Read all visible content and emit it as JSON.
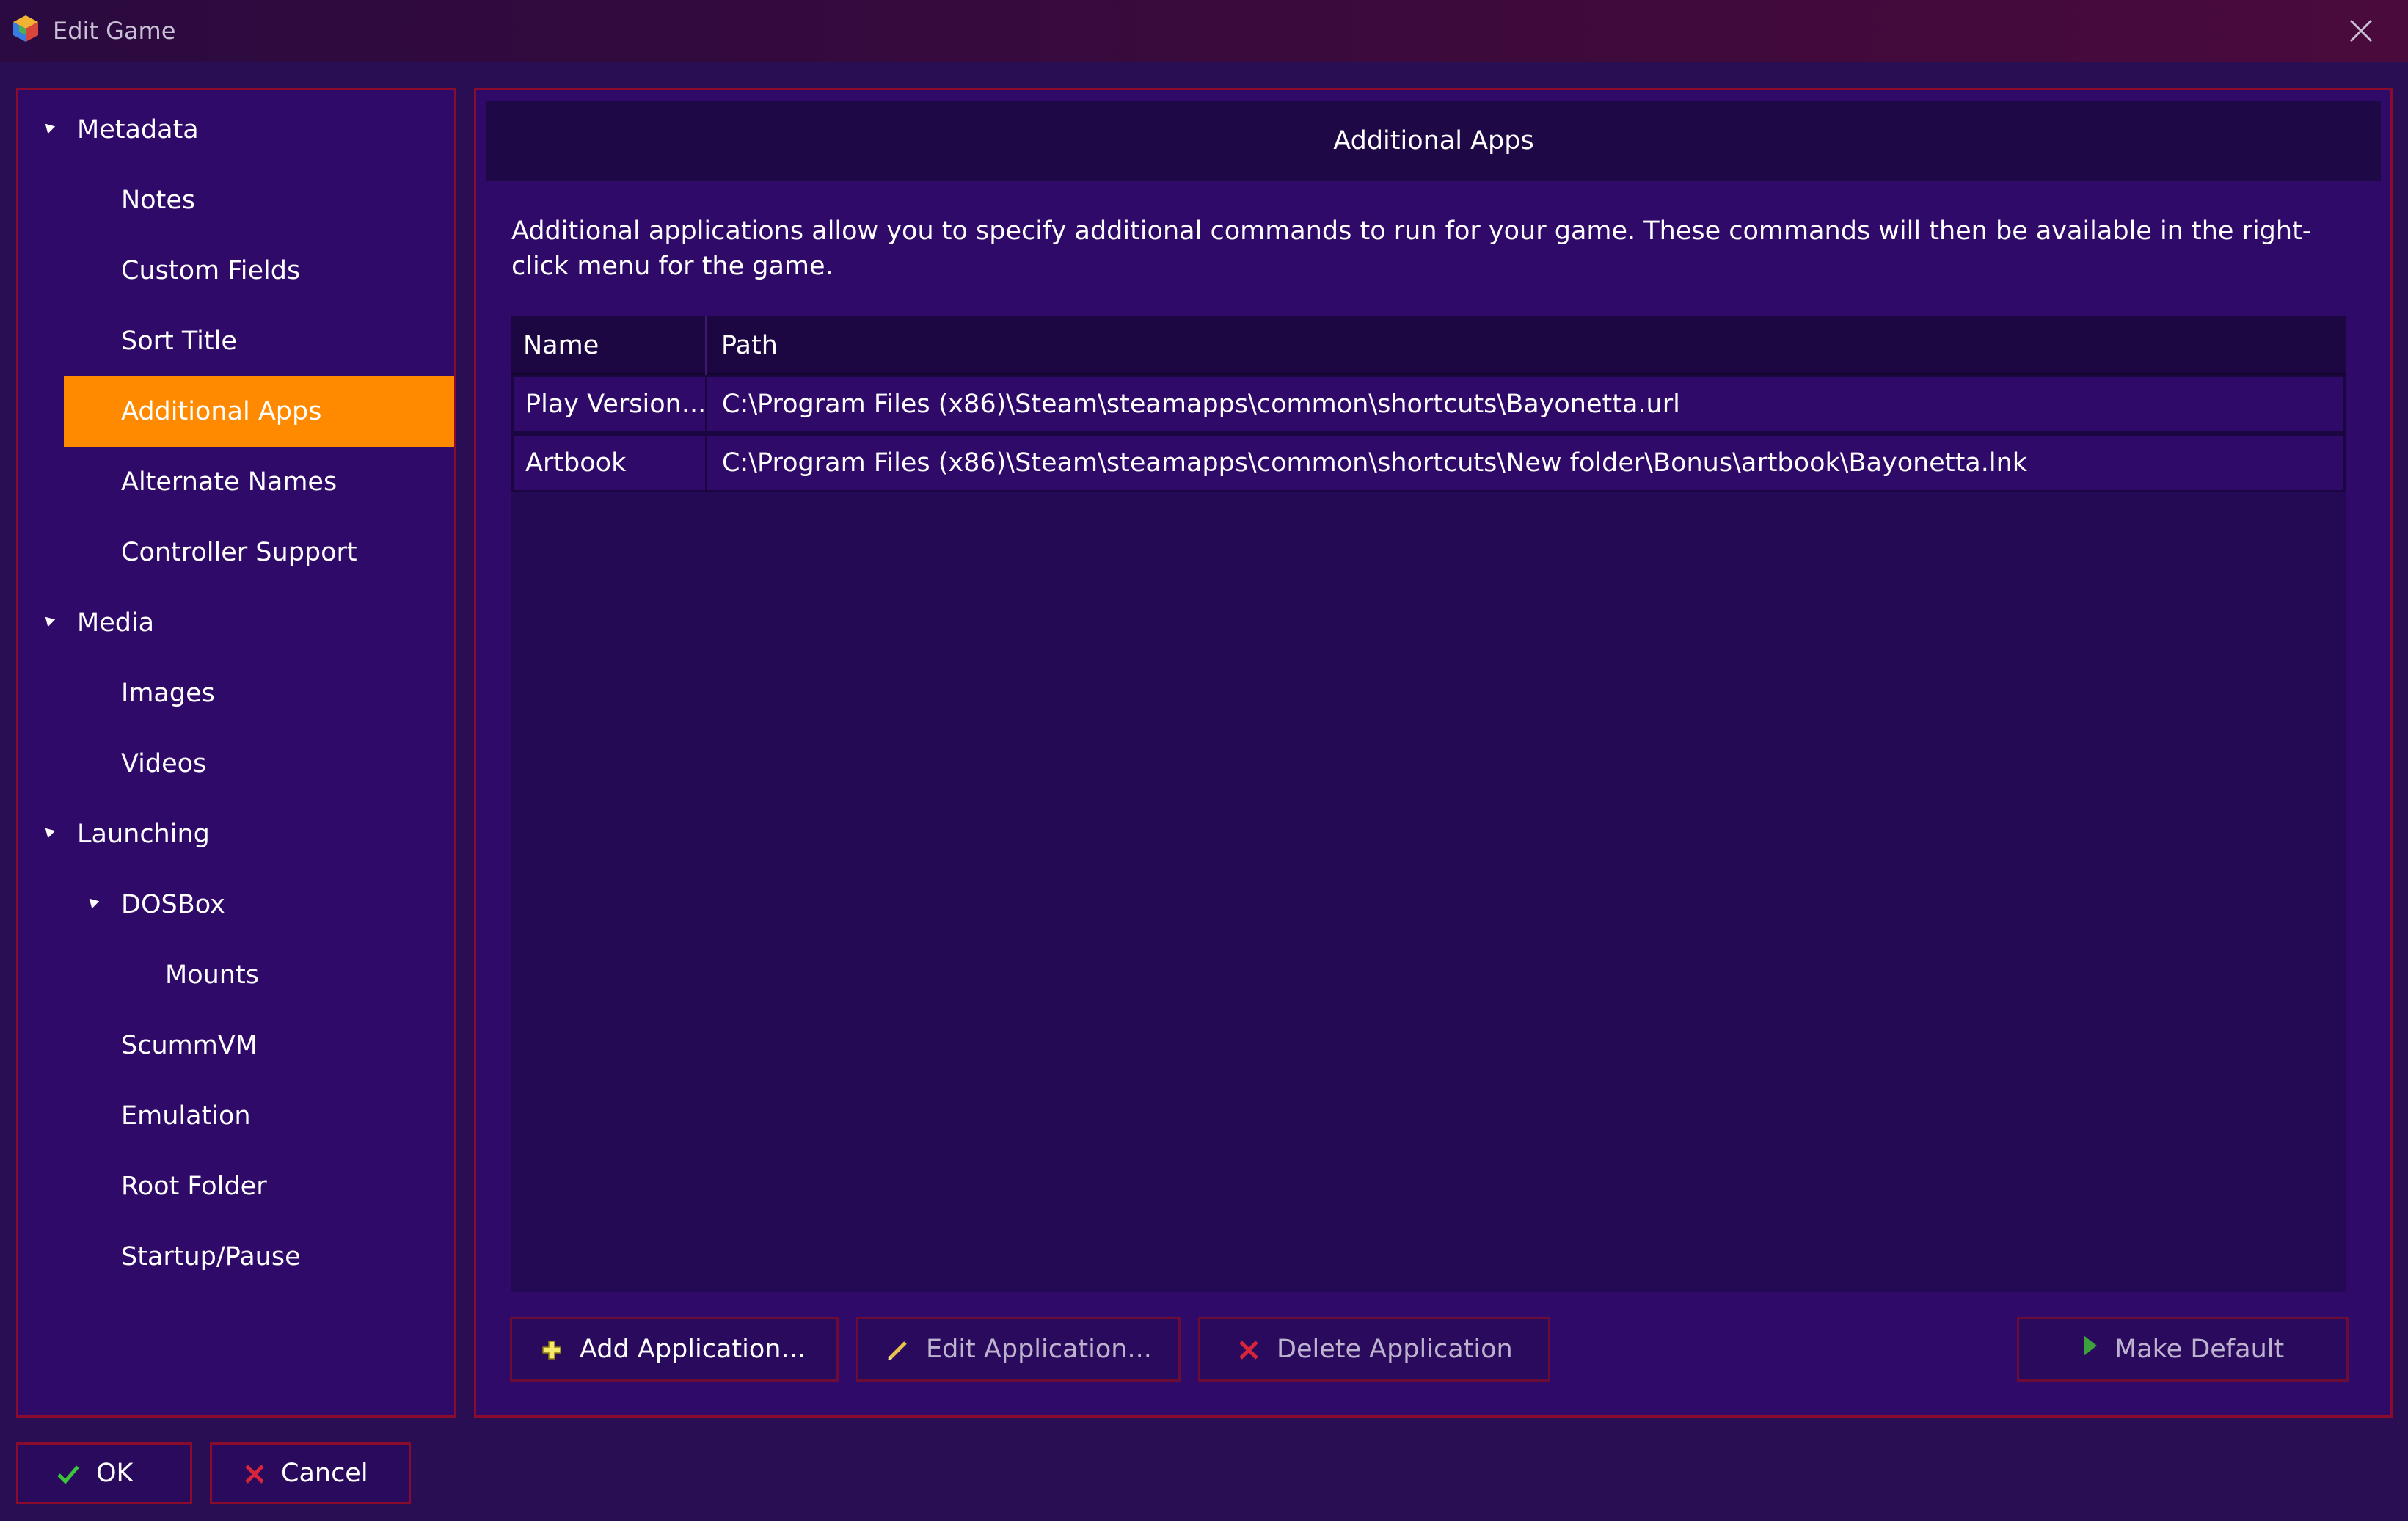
{
  "window": {
    "title": "Edit Game"
  },
  "sidebar": {
    "items": [
      {
        "label": "Metadata",
        "level": 0,
        "expanded": true
      },
      {
        "label": "Notes",
        "level": 1
      },
      {
        "label": "Custom Fields",
        "level": 1
      },
      {
        "label": "Sort Title",
        "level": 1
      },
      {
        "label": "Additional Apps",
        "level": 1,
        "selected": true
      },
      {
        "label": "Alternate Names",
        "level": 1
      },
      {
        "label": "Controller Support",
        "level": 1
      },
      {
        "label": "Media",
        "level": 0,
        "expanded": true
      },
      {
        "label": "Images",
        "level": 1
      },
      {
        "label": "Videos",
        "level": 1
      },
      {
        "label": "Launching",
        "level": 0,
        "expanded": true
      },
      {
        "label": "DOSBox",
        "level": 1,
        "expanded": true
      },
      {
        "label": "Mounts",
        "level": 2
      },
      {
        "label": "ScummVM",
        "level": 1
      },
      {
        "label": "Emulation",
        "level": 1
      },
      {
        "label": "Root Folder",
        "level": 1
      },
      {
        "label": "Startup/Pause",
        "level": 1
      }
    ]
  },
  "main": {
    "header": "Additional Apps",
    "description": "Additional applications allow you to specify additional commands to run for your game.  These commands will then be available in the right-click menu for the game.",
    "table": {
      "columns": [
        "Name",
        "Path"
      ],
      "rows": [
        {
          "name": "Play  Version...",
          "path": "C:\\Program Files (x86)\\Steam\\steamapps\\common\\shortcuts\\Bayonetta.url"
        },
        {
          "name": "Artbook",
          "path": "C:\\Program Files (x86)\\Steam\\steamapps\\common\\shortcuts\\New folder\\Bonus\\artbook\\Bayonetta.lnk"
        }
      ]
    },
    "buttons": {
      "add": "Add Application...",
      "edit": "Edit Application...",
      "delete": "Delete Application",
      "make_default": "Make Default"
    }
  },
  "footer": {
    "ok": "OK",
    "cancel": "Cancel"
  },
  "colors": {
    "background": "#2a0e54",
    "panel": "#2f0a68",
    "border": "#8a0c2c",
    "selected": "#ff8a00",
    "header_band": "#1e0845"
  }
}
